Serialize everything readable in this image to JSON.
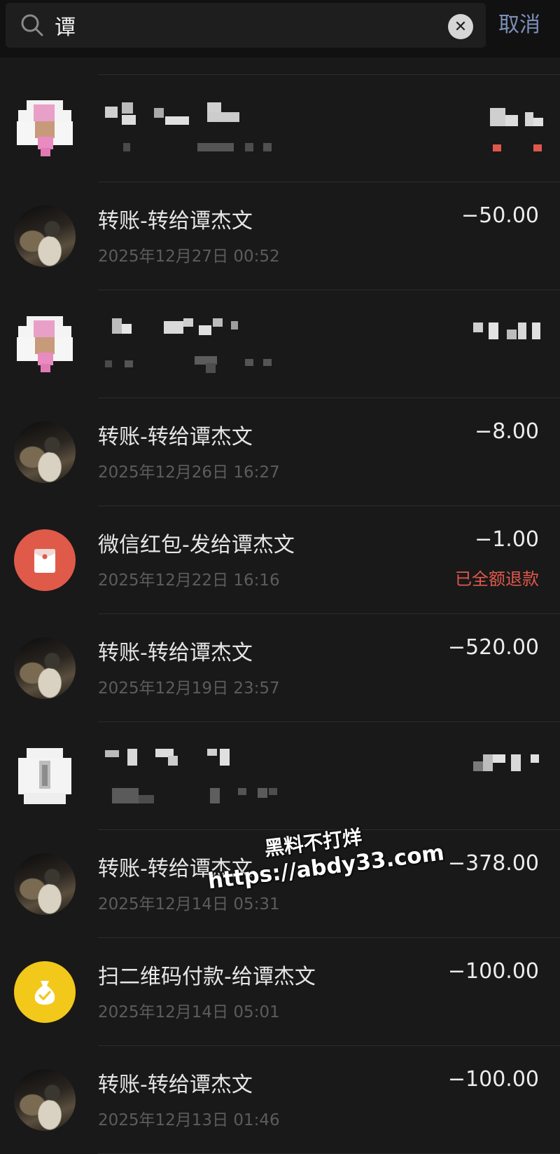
{
  "search": {
    "query": "谭",
    "cancel_label": "取消"
  },
  "colors": {
    "background": "#191919",
    "accent_link": "#7b8fb8",
    "refund_red": "#e0584c",
    "redpacket": "#e05a4a",
    "pay_yellow": "#f2c81a"
  },
  "transactions": [
    {
      "title": "",
      "time": "",
      "amount": "",
      "pixelated": true
    },
    {
      "title": "转账-转给谭杰文",
      "time": "2025年12月27日 00:52",
      "amount": "−50.00",
      "avatar": "contact-photo"
    },
    {
      "title": "",
      "time": "",
      "amount": "",
      "pixelated": true
    },
    {
      "title": "转账-转给谭杰文",
      "time": "2025年12月26日 16:27",
      "amount": "−8.00",
      "avatar": "contact-photo"
    },
    {
      "title": "微信红包-发给谭杰文",
      "time": "2025年12月22日 16:16",
      "amount": "−1.00",
      "status": "已全额退款",
      "avatar": "red-packet-icon"
    },
    {
      "title": "转账-转给谭杰文",
      "time": "2025年12月19日 23:57",
      "amount": "−520.00",
      "avatar": "contact-photo"
    },
    {
      "title": "",
      "time": "",
      "amount": "",
      "pixelated": true
    },
    {
      "title": "转账-转给谭杰文",
      "time": "2025年12月14日 05:31",
      "amount": "−378.00",
      "avatar": "contact-photo"
    },
    {
      "title": "扫二维码付款-给谭杰文",
      "time": "2025年12月14日 05:01",
      "amount": "−100.00",
      "avatar": "money-bag-icon"
    },
    {
      "title": "转账-转给谭杰文",
      "time": "2025年12月13日 01:46",
      "amount": "−100.00",
      "avatar": "contact-photo"
    }
  ],
  "watermark": {
    "line1": "黑料不打烊",
    "line2": "https://abdy33.com"
  }
}
